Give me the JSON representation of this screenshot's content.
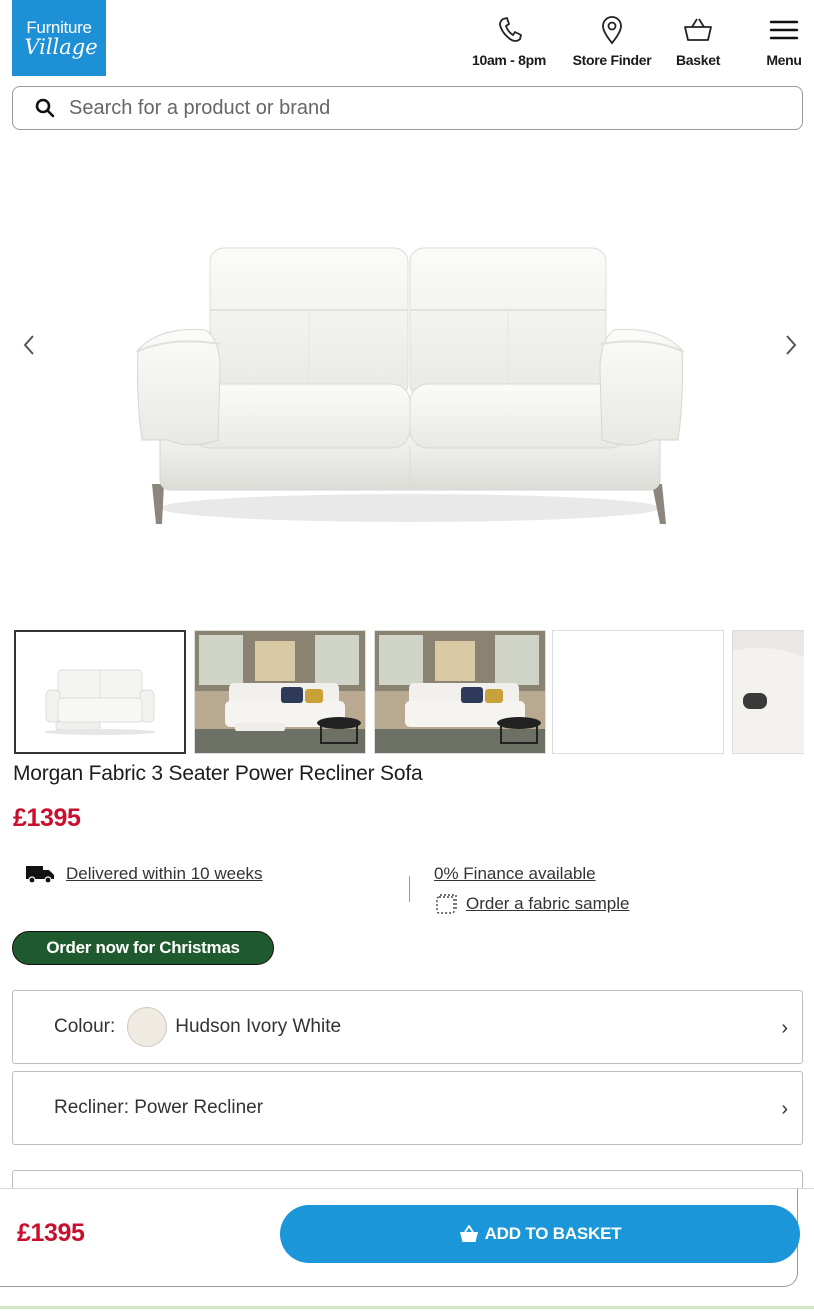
{
  "brand": {
    "line1": "Furniture",
    "line2": "Village",
    "color": "#1e90d6"
  },
  "header": {
    "hours": "10am - 8pm",
    "store_finder": "Store Finder",
    "basket": "Basket",
    "menu": "Menu"
  },
  "search": {
    "placeholder": "Search for a product or brand"
  },
  "product": {
    "title": "Morgan Fabric 3 Seater Power Recliner Sofa",
    "price": "£1395",
    "delivery": "Delivered within 10 weeks",
    "finance": "0% Finance available",
    "fabric_sample": "Order a fabric sample",
    "badge": "Order now for Christmas"
  },
  "options": {
    "colour_label": "Colour:",
    "colour_value": "Hudson Ivory White",
    "recliner": "Recliner: Power Recliner"
  },
  "sticky": {
    "price": "£1395",
    "add_to_basket": "ADD TO BASKET"
  },
  "colors": {
    "price_red": "#c8102e",
    "button_blue": "#1a96d9",
    "badge_green": "#1f5a2e"
  }
}
